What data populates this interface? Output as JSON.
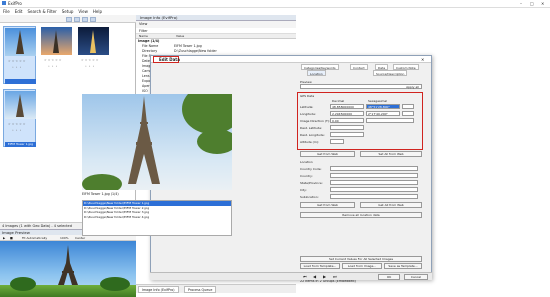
{
  "app": {
    "title": "ExifPro",
    "menu": [
      "File",
      "Edit",
      "Search & Filter",
      "Setup",
      "View",
      "Help"
    ]
  },
  "folder": {
    "path": "D:\\Zuschlagge\\New folder"
  },
  "thumbnails": [
    {
      "label": "",
      "selected": true
    },
    {
      "label": "",
      "selected": false
    },
    {
      "label": "",
      "selected": false
    },
    {
      "label": "EIFM Tower 1.jpg",
      "selected": true
    }
  ],
  "status": {
    "left": "4 Images (1 with Geo Data) - 4 selected"
  },
  "preview": {
    "title": "Image Preview",
    "fit": "Fit Automatically",
    "zoom": "100%",
    "center": "Center"
  },
  "info_panel": {
    "title": "Image Info (EvifPro)",
    "view": "View",
    "filter": "Filter",
    "columns": [
      "Name",
      "Value"
    ],
    "group": "Image (1/4)",
    "rows": [
      {
        "k": "File Name",
        "v": "EIFM Tower 1.jpg"
      },
      {
        "k": "Directory",
        "v": "D:\\Zuschlagge\\New folder"
      },
      {
        "k": "File Size",
        "v": ""
      },
      {
        "k": "Date",
        "v": ""
      },
      {
        "k": "Image",
        "v": ""
      },
      {
        "k": "Camera",
        "v": ""
      },
      {
        "k": "Lens",
        "v": ""
      },
      {
        "k": "Expo",
        "v": ""
      },
      {
        "k": "Aper",
        "v": ""
      },
      {
        "k": "ISO",
        "v": ""
      },
      {
        "k": "Flash",
        "v": ""
      },
      {
        "k": "Focal",
        "v": ""
      },
      {
        "k": "Meter",
        "v": ""
      },
      {
        "k": "Exp",
        "v": ""
      },
      {
        "k": "Whi",
        "v": ""
      }
    ],
    "footer": "22 Items in 2 Groups  (Embedded)",
    "tabs": [
      "Image Info (ExifPro)",
      "Process Queue"
    ]
  },
  "dialog": {
    "title": "Edit Data",
    "file_label": "EIFM Tower 1.jpg (1/4)",
    "files": [
      "D:\\Zuschlagge\\New folder\\EIFM Tower 1.jpg",
      "D:\\Zuschlagge\\New folder\\EIFM Tower 2.jpg",
      "D:\\Zuschlagge\\New folder\\EIFM Tower 3.jpg",
      "D:\\Zuschlagge\\New folder\\EIFM Tower 4.jpg"
    ],
    "tabs": [
      "Categories/Keywords",
      "Contact",
      "Date",
      "Custom Note",
      "Location",
      "Source/Description"
    ],
    "preview_label": "Preview",
    "apply": "Apply all",
    "gps": {
      "header": "GPS Data",
      "decimal": "Decimal",
      "sexagesimal": "Sexagesimal",
      "latitude": {
        "label": "Latitude:",
        "dec": "48.858000000",
        "sex": "48°51'28.800\""
      },
      "longitude": {
        "label": "Longitude:",
        "dec": "2.294500000",
        "sex": "2°17'40.200\""
      },
      "direction": {
        "label": "Image Direction (T):",
        "val": "0.00"
      },
      "dest_lat": {
        "label": "Dest. Latitude:"
      },
      "dest_lon": {
        "label": "Dest. Longitude:"
      },
      "altitude": {
        "label": "Altitude (m):"
      },
      "get_from": "Get from Web",
      "set_all": "Set All from Web"
    },
    "location": {
      "header": "Location",
      "country_code": "Country Code:",
      "country": "Country:",
      "state": "State/Province:",
      "city": "City:",
      "sublocation": "Sublocation:",
      "get_web": "Get from Web",
      "get_all": "Get All from Web",
      "remove": "Remove all location data"
    },
    "bottom": {
      "set_current": "Set Current Values For All Selected Images",
      "load_template": "Load from Template...",
      "load_from_image": "Load from Image...",
      "save_template": "Save as Template...",
      "ok": "OK",
      "cancel": "Cancel"
    }
  }
}
